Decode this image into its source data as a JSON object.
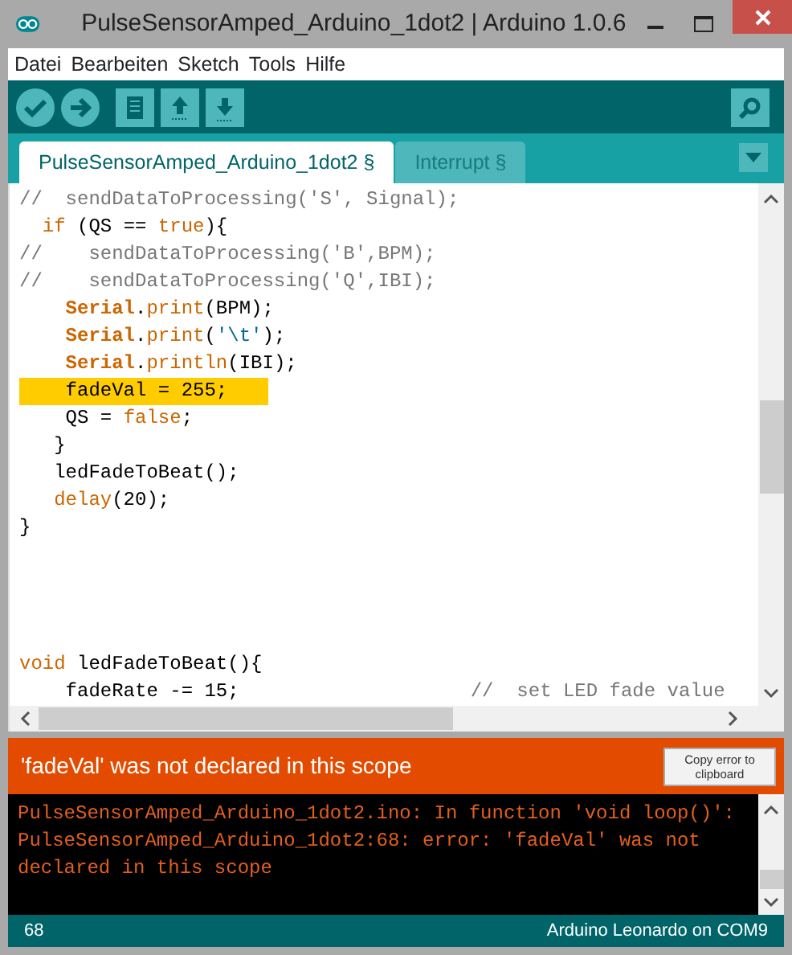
{
  "window": {
    "title": "PulseSensorAmped_Arduino_1dot2 | Arduino 1.0.6"
  },
  "menu": [
    "Datei",
    "Bearbeiten",
    "Sketch",
    "Tools",
    "Hilfe"
  ],
  "tabs": [
    {
      "label": "PulseSensorAmped_Arduino_1dot2 §",
      "selected": true
    },
    {
      "label": "Interrupt §",
      "selected": false
    }
  ],
  "code_blocks": [
    {
      "lines": [
        {
          "highlighted": false,
          "tokens": [
            {
              "kind": "comment",
              "text": "//  sendDataToProcessing('S', Signal);"
            }
          ]
        },
        {
          "highlighted": false,
          "tokens": [
            {
              "kind": "keyword",
              "text": "  if"
            },
            {
              "kind": "plain",
              "text": " (QS == "
            },
            {
              "kind": "keyword",
              "text": "true"
            },
            {
              "kind": "plain",
              "text": "){"
            }
          ]
        },
        {
          "highlighted": false,
          "tokens": [
            {
              "kind": "comment",
              "text": "//    sendDataToProcessing('B',BPM);"
            }
          ]
        },
        {
          "highlighted": false,
          "tokens": [
            {
              "kind": "comment",
              "text": "//    sendDataToProcessing('Q',IBI);"
            }
          ]
        },
        {
          "highlighted": false,
          "tokens": [
            {
              "kind": "class",
              "text": "    Serial"
            },
            {
              "kind": "plain",
              "text": "."
            },
            {
              "kind": "keyword",
              "text": "print"
            },
            {
              "kind": "plain",
              "text": "(BPM);"
            }
          ]
        },
        {
          "highlighted": false,
          "tokens": [
            {
              "kind": "class",
              "text": "    Serial"
            },
            {
              "kind": "plain",
              "text": "."
            },
            {
              "kind": "keyword",
              "text": "print"
            },
            {
              "kind": "plain",
              "text": "("
            },
            {
              "kind": "string",
              "text": "'\\t'"
            },
            {
              "kind": "plain",
              "text": ");"
            }
          ]
        },
        {
          "highlighted": false,
          "tokens": [
            {
              "kind": "class",
              "text": "    Serial"
            },
            {
              "kind": "plain",
              "text": "."
            },
            {
              "kind": "keyword",
              "text": "println"
            },
            {
              "kind": "plain",
              "text": "(IBI);"
            }
          ]
        },
        {
          "highlighted": true,
          "tokens": [
            {
              "kind": "plain",
              "text": "    fadeVal = 255;"
            }
          ]
        },
        {
          "highlighted": false,
          "tokens": [
            {
              "kind": "plain",
              "text": "    QS = "
            },
            {
              "kind": "keyword",
              "text": "false"
            },
            {
              "kind": "plain",
              "text": ";"
            }
          ]
        },
        {
          "highlighted": false,
          "tokens": [
            {
              "kind": "plain",
              "text": "   }"
            }
          ]
        },
        {
          "highlighted": false,
          "tokens": [
            {
              "kind": "plain",
              "text": "   ledFadeToBeat();"
            }
          ]
        },
        {
          "highlighted": false,
          "tokens": [
            {
              "kind": "keyword",
              "text": "   delay"
            },
            {
              "kind": "plain",
              "text": "(20);"
            }
          ]
        },
        {
          "highlighted": false,
          "tokens": [
            {
              "kind": "plain",
              "text": "}"
            }
          ]
        }
      ]
    },
    {
      "lines": [
        {
          "highlighted": false,
          "tokens": [
            {
              "kind": "keyword",
              "text": "void"
            },
            {
              "kind": "plain",
              "text": " ledFadeToBeat(){"
            }
          ]
        },
        {
          "highlighted": false,
          "tokens": [
            {
              "kind": "plain",
              "text": "    fadeRate -= 15;                    "
            },
            {
              "kind": "comment",
              "text": "//  set LED fade value"
            }
          ]
        }
      ]
    }
  ],
  "error_bar": {
    "message": "'fadeVal' was not declared in this scope",
    "copy_button": "Copy error to clipboard"
  },
  "console_lines": [
    "PulseSensorAmped_Arduino_1dot2.ino: In function 'void loop()':",
    "PulseSensorAmped_Arduino_1dot2:68: error: 'fadeVal' was not declared in this scope"
  ],
  "status_bar": {
    "line": "68",
    "board": "Arduino Leonardo on COM9"
  }
}
